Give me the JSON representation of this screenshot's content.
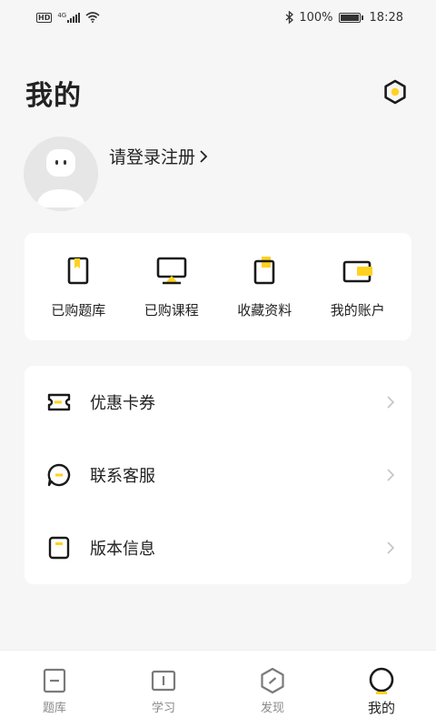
{
  "status_bar": {
    "network": "HD",
    "signal_text": "4G",
    "battery": "100%",
    "time": "18:28"
  },
  "header": {
    "title": "我的",
    "settings_icon": "gear-hexagon-icon"
  },
  "profile": {
    "login_text": "请登录注册",
    "arrow": "›"
  },
  "quick_actions": [
    {
      "label": "已购题库",
      "icon": "question-bank-icon"
    },
    {
      "label": "已购课程",
      "icon": "course-icon"
    },
    {
      "label": "收藏资料",
      "icon": "favorite-icon"
    },
    {
      "label": "我的账户",
      "icon": "wallet-icon"
    }
  ],
  "menu": [
    {
      "label": "优惠卡券",
      "icon": "coupon-icon"
    },
    {
      "label": "联系客服",
      "icon": "chat-icon"
    },
    {
      "label": "版本信息",
      "icon": "info-icon"
    }
  ],
  "bottom_nav": [
    {
      "label": "题库",
      "active": false
    },
    {
      "label": "学习",
      "active": false
    },
    {
      "label": "发现",
      "active": false
    },
    {
      "label": "我的",
      "active": true
    }
  ],
  "colors": {
    "accent": "#ffd21f",
    "icon": "#1a1a1a",
    "background": "#f6f6f6"
  }
}
